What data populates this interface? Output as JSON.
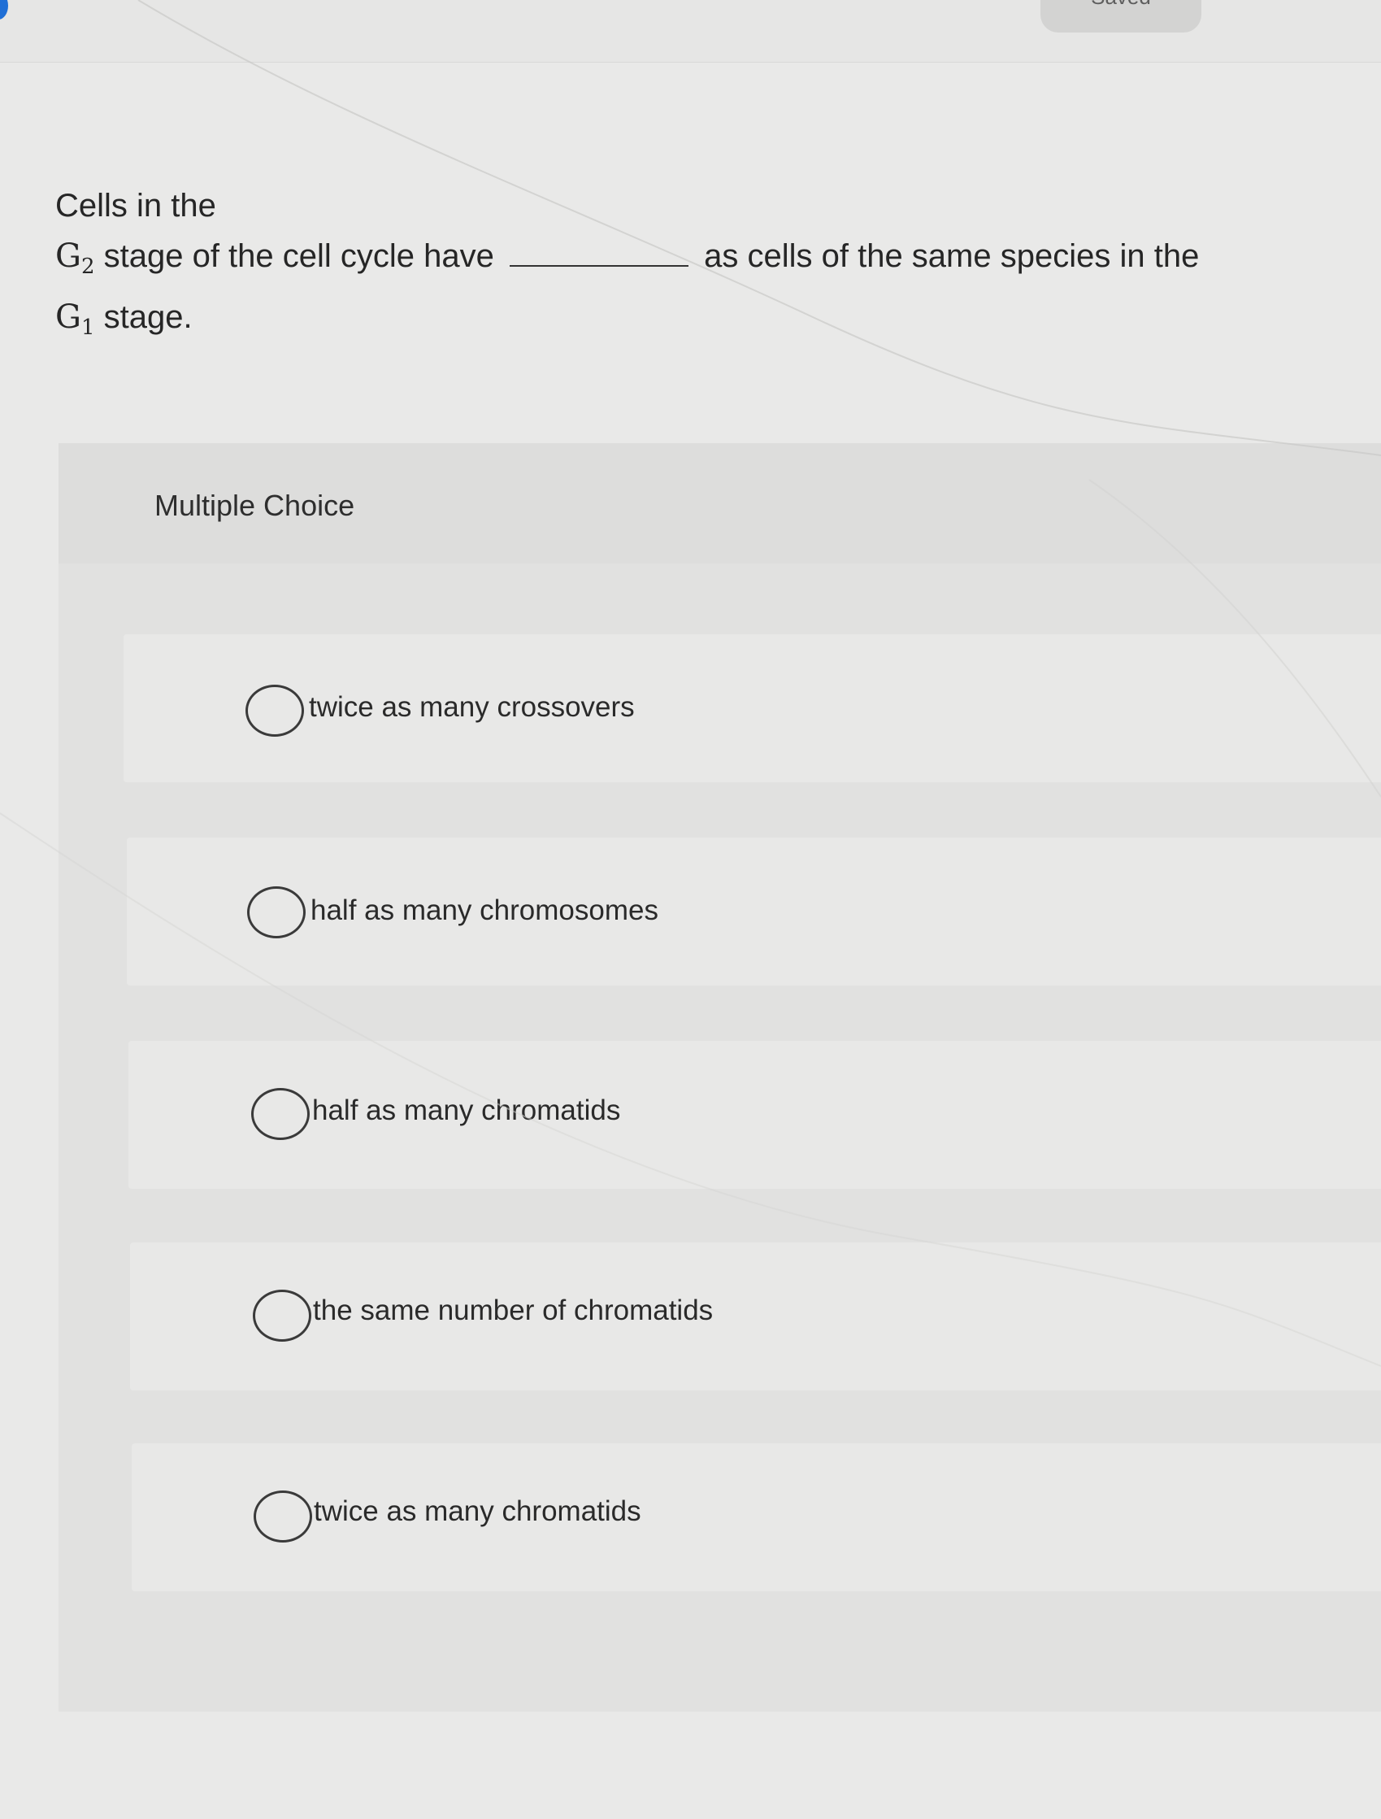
{
  "header": {
    "saved_label": "Saved"
  },
  "question": {
    "line1": "Cells in the",
    "g2_symbol": "G",
    "g2_sub": "2",
    "line2_text": " stage of the cell cycle have ",
    "line2_tail": " as cells of the same species in the",
    "g1_symbol": "G",
    "g1_sub": "1",
    "line3_text": " stage."
  },
  "multiple_choice": {
    "title": "Multiple Choice",
    "options": [
      {
        "label": "twice as many crossovers"
      },
      {
        "label": "half as many chromosomes"
      },
      {
        "label": "half as many chromatids"
      },
      {
        "label": "the same number of chromatids"
      },
      {
        "label": "twice as many chromatids"
      }
    ]
  }
}
